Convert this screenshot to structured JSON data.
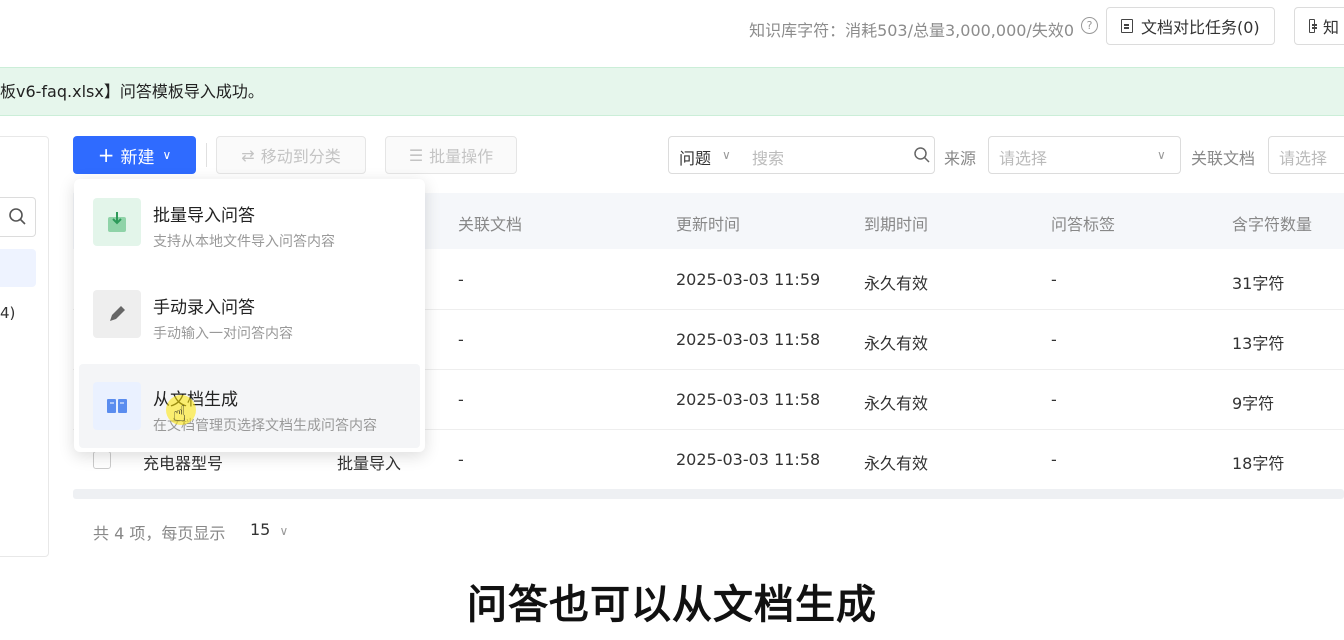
{
  "header": {
    "stats": "知识库字符：消耗503/总量3,000,000/失效0",
    "help_icon": "?",
    "compare_button": "文档对比任务(0)",
    "second_button": "知"
  },
  "alert": {
    "message": "板v6-faq.xlsx】问答模板导入成功。"
  },
  "sidebar": {
    "count": "4)"
  },
  "toolbar": {
    "new_label": "新建",
    "move_label": "移动到分类",
    "batch_label": "批量操作",
    "filter_field": "问题",
    "search_placeholder": "搜索",
    "source_label": "来源",
    "source_placeholder": "请选择",
    "linked_doc_label": "关联文档",
    "linked_doc_placeholder": "请选择"
  },
  "table": {
    "headers": [
      "关联文档",
      "更新时间",
      "到期时间",
      "问答标签",
      "含字符数量"
    ],
    "rows": [
      {
        "name": "",
        "source": "",
        "linked": "-",
        "updated": "2025-03-03 11:59",
        "expire": "永久有效",
        "tag": "-",
        "chars": "31字符"
      },
      {
        "name": "",
        "source": "",
        "linked": "-",
        "updated": "2025-03-03 11:58",
        "expire": "永久有效",
        "tag": "-",
        "chars": "13字符"
      },
      {
        "name": "",
        "source": "",
        "linked": "-",
        "updated": "2025-03-03 11:58",
        "expire": "永久有效",
        "tag": "-",
        "chars": "9字符"
      },
      {
        "name": "充电器型号",
        "source": "批量导入",
        "linked": "-",
        "updated": "2025-03-03 11:58",
        "expire": "永久有效",
        "tag": "-",
        "chars": "18字符"
      }
    ]
  },
  "pager": {
    "total": "共 4 项，每页显示",
    "page_size": "15"
  },
  "dropdown": {
    "items": [
      {
        "title": "批量导入问答",
        "desc": "支持从本地文件导入问答内容"
      },
      {
        "title": "手动录入问答",
        "desc": "手动输入一对问答内容"
      },
      {
        "title": "从文档生成",
        "desc": "在文档管理页选择文档生成问答内容"
      }
    ]
  },
  "caption": "问答也可以从文档生成",
  "colors": {
    "primary": "#2f6bff",
    "alert_bg": "#e6f6ec"
  }
}
